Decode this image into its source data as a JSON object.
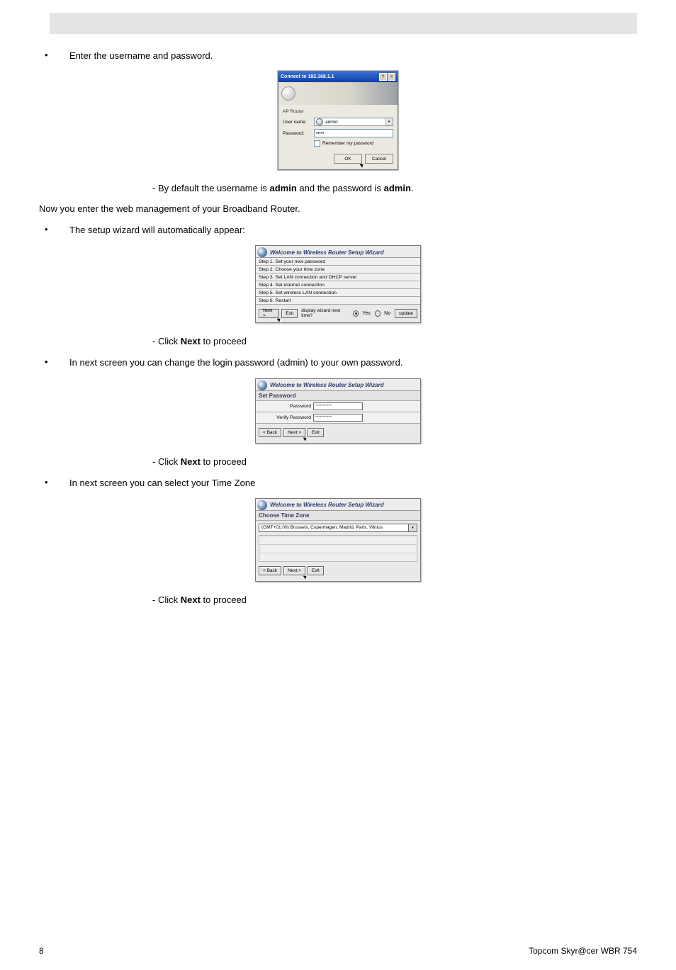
{
  "intro_bullet": "Enter the username and password.",
  "login_dialog": {
    "title": "Connect to 192.168.1.1",
    "section": "AP Router",
    "field_user_label": "User name:",
    "field_pass_label": "Password:",
    "user_value": "admin",
    "pass_value": "•••••",
    "remember": "Remember my password",
    "ok": "OK",
    "cancel": "Cancel"
  },
  "note_default_prefix": "- By default the username is ",
  "note_default_bold1": "admin",
  "note_default_mid": " and the password is ",
  "note_default_bold2": "admin",
  "note_default_suffix": ".",
  "body_now": "Now you enter the web management of your Broadband Router.",
  "bullet_wizard": "The setup wizard will automatically appear:",
  "wizard1": {
    "title": "Welcome to Wireless Router Setup Wizard",
    "steps": [
      "Step 1. Set your new password",
      "Step 2. Choose your time zone",
      "Step 3. Set LAN connection and DHCP server",
      "Step 4. Set internet connection",
      "Step 5. Set wireless LAN connection",
      "Step 6. Restart"
    ],
    "btn_next": "Next >",
    "btn_exit": "Exit",
    "display_text": "display wizard next time?",
    "opt_yes": "Yes",
    "opt_no": "No",
    "btn_update": "update"
  },
  "note_click_next": "- Click ",
  "note_click_next_bold": "Next",
  "note_click_next_suffix": " to proceed",
  "bullet_change_pw": "In next screen you can change the login password (admin) to your own password.",
  "wizard2": {
    "title": "Welcome to Wireless Router Setup Wizard",
    "subtitle": "Set Password",
    "lbl_pass": "Password",
    "lbl_verify": "Verify Password",
    "mask": "•••••••••••",
    "btn_back": "< Back",
    "btn_next": "Next >",
    "btn_exit": "Exit"
  },
  "bullet_timezone": "In next screen you can select your Time Zone",
  "wizard3": {
    "title": "Welcome to Wireless Router Setup Wizard",
    "subtitle": "Choose Time Zone",
    "tz_value": "(GMT+01:00) Brussels, Copenhagen, Madrid, Paris, Vilnius",
    "btn_back": "< Back",
    "btn_next": "Next >",
    "btn_exit": "Exit"
  },
  "footer_page": "8",
  "footer_product": "Topcom Skyr@cer WBR 754"
}
